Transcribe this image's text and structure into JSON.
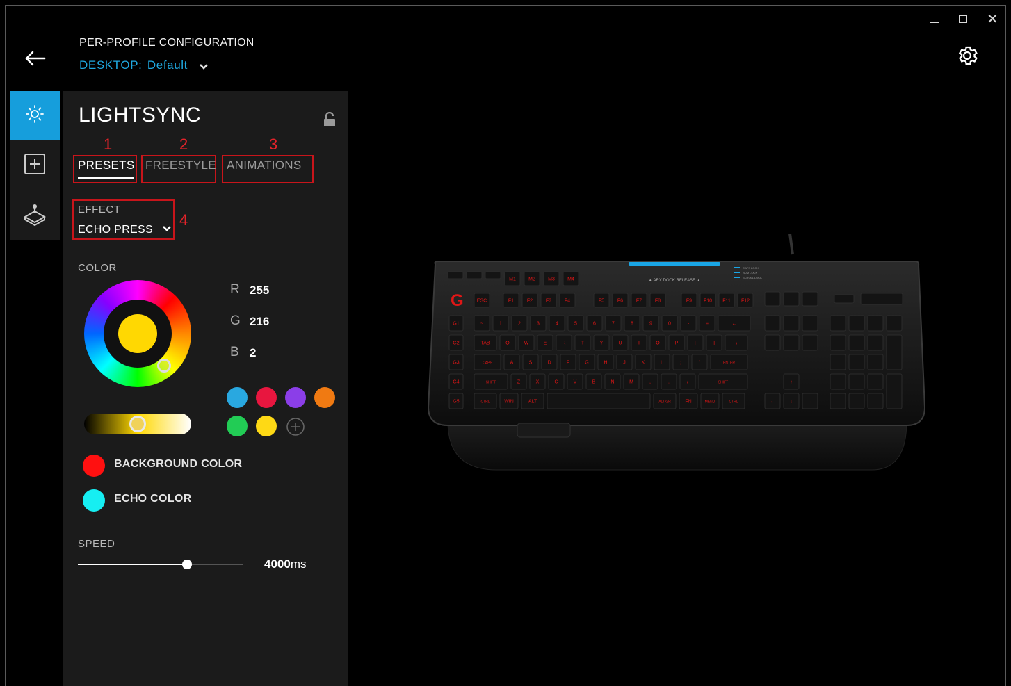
{
  "header": {
    "subtitle": "PER-PROFILE CONFIGURATION",
    "profile_prefix": "DESKTOP:",
    "profile_name": "Default"
  },
  "window": {
    "minimize_icon": "minimize-icon",
    "maximize_icon": "maximize-icon",
    "close_icon": "close-icon"
  },
  "sidebar": {
    "items": [
      {
        "icon": "lightsync-sun-icon",
        "active": true
      },
      {
        "icon": "plus-square-icon",
        "active": false
      },
      {
        "icon": "joystick-icon",
        "active": false
      }
    ]
  },
  "panel": {
    "title": "LIGHTSYNC",
    "lock_icon": "unlock-icon",
    "tabs": [
      {
        "label": "PRESETS",
        "marker": "1",
        "active": true
      },
      {
        "label": "FREESTYLE",
        "marker": "2",
        "active": false
      },
      {
        "label": "ANIMATIONS",
        "marker": "3",
        "active": false
      }
    ],
    "effect": {
      "label": "EFFECT",
      "value": "ECHO PRESS",
      "marker": "4"
    },
    "color": {
      "label": "COLOR",
      "selected_hex": "#FFD802",
      "r_label": "R",
      "r": "255",
      "g_label": "G",
      "g": "216",
      "b_label": "B",
      "b": "2",
      "brightness_level": 0.5,
      "swatches": [
        "#29a8e0",
        "#e8163f",
        "#8b3ee8",
        "#f07a12",
        "#22cc55",
        "#fed915"
      ],
      "add_swatch_icon": "plus-circle-icon"
    },
    "background_color": {
      "label": "BACKGROUND COLOR",
      "hex": "#ff1010"
    },
    "echo_color": {
      "label": "ECHO COLOR",
      "hex": "#16eef2"
    },
    "speed": {
      "label": "SPEED",
      "value_number": "4000",
      "value_unit": "ms",
      "level": 0.66
    }
  },
  "settings_icon": "gear-icon",
  "keyboard": {
    "top_label": "ARX DOCK RELEASE",
    "status_labels": [
      "CAPS LOCK",
      "NUM LOCK",
      "SCROLL LOCK"
    ],
    "accent_hex": "#1aa6e6",
    "key_hex": "#e01616",
    "row_labels": [
      [
        "ESC",
        "F1",
        "F2",
        "F3",
        "F4",
        "F5",
        "F6",
        "F7",
        "F8",
        "F9",
        "F10",
        "F11",
        "F12"
      ],
      [
        "~",
        "1",
        "2",
        "3",
        "4",
        "5",
        "6",
        "7",
        "8",
        "9",
        "0",
        "-",
        "=",
        "←"
      ],
      [
        "TAB",
        "Q",
        "W",
        "E",
        "R",
        "T",
        "Y",
        "U",
        "I",
        "O",
        "P",
        "[",
        "]",
        "\\"
      ],
      [
        "CAPS",
        "A",
        "S",
        "D",
        "F",
        "G",
        "H",
        "J",
        "K",
        "L",
        ";",
        "'",
        "ENTER"
      ],
      [
        "SHIFT",
        "Z",
        "X",
        "C",
        "V",
        "B",
        "N",
        "M",
        ",",
        ".",
        "/",
        "SHIFT"
      ],
      [
        "CTRL",
        "WIN",
        "ALT",
        "",
        "ALT GR",
        "FN",
        "MENU",
        "CTRL"
      ]
    ]
  }
}
